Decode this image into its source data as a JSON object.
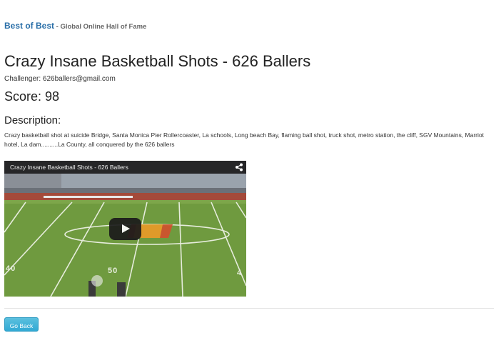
{
  "header": {
    "brand": "Best of Best",
    "tagline": " - Global Online Hall of Fame"
  },
  "entry": {
    "title": "Crazy Insane Basketball Shots - 626 Ballers",
    "challenger": "Challenger: 626ballers@gmail.com",
    "score": "Score: 98",
    "description_heading": "Description:",
    "description": "Crazy basketball shot at suicide Bridge, Santa Monica Pier Rollercoaster, La schools, Long beach Bay, flaming ball shot, truck shot, metro station, the cliff, SGV Mountains, Marriot hotel, La dam..........La County, all conquered by the 626 ballers"
  },
  "video": {
    "title": "Crazy Insane Basketball Shots - 626 Ballers",
    "icons": [
      "share-icon",
      "play-icon"
    ],
    "yard_markers": [
      "40",
      "50",
      "4"
    ]
  },
  "actions": {
    "back_label": "Go Back"
  },
  "colors": {
    "brand": "#2a6fa8",
    "button": "#5bc0de",
    "field_green": "#6f9a3f",
    "track": "#a44a3a"
  }
}
